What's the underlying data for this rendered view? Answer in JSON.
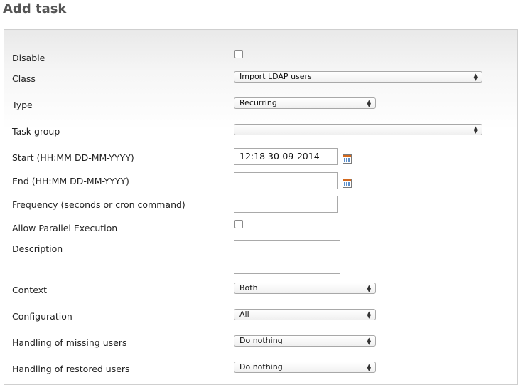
{
  "page": {
    "title": "Add task"
  },
  "form": {
    "disable": {
      "label": "Disable",
      "checked": false
    },
    "class": {
      "label": "Class",
      "value": "Import LDAP users"
    },
    "type": {
      "label": "Type",
      "value": "Recurring"
    },
    "task_group": {
      "label": "Task group",
      "value": ""
    },
    "start": {
      "label": "Start (HH:MM DD-MM-YYYY)",
      "value": "12:18 30-09-2014"
    },
    "end": {
      "label": "End (HH:MM DD-MM-YYYY)",
      "value": ""
    },
    "frequency": {
      "label": "Frequency (seconds or cron command)",
      "value": ""
    },
    "parallel": {
      "label": "Allow Parallel Execution",
      "checked": false
    },
    "description": {
      "label": "Description",
      "value": ""
    },
    "context": {
      "label": "Context",
      "value": "Both"
    },
    "configuration": {
      "label": "Configuration",
      "value": "All"
    },
    "missing_users": {
      "label": "Handling of missing users",
      "value": "Do nothing"
    },
    "restored_users": {
      "label": "Handling of restored users",
      "value": "Do nothing"
    }
  },
  "icons": {
    "select_arrows": "updown-arrows-icon",
    "date_picker": "calendar-icon"
  },
  "colors": {
    "title": "#555555",
    "calendar_accent": "#d2691e"
  }
}
